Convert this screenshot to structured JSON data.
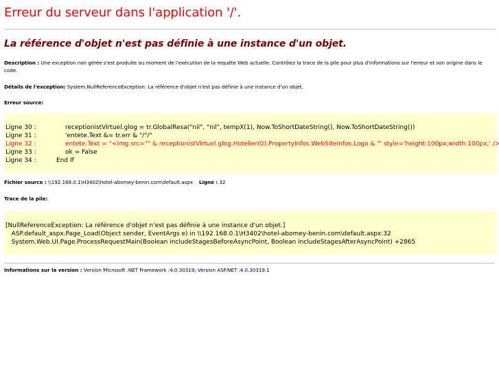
{
  "server_error_title": "Erreur du serveur dans l'application '/'.",
  "error_title": "La référence d'objet n'est pas définie à une instance d'un objet.",
  "description": {
    "label": "Description :",
    "text": " Une exception non gérée s'est produite au moment de l'exécution de la requête Web actuelle. Contrôlez la trace de la pile pour plus d'informations sur l'erreur et son origine dans le code."
  },
  "exception_details": {
    "label": "Détails de l'exception:",
    "text": " System.NullReferenceException: La référence d'objet n'est pas définie à une instance d'un objet."
  },
  "source_error_label": "Erreur source:",
  "source_lines": [
    {
      "label": "Ligne 30 :",
      "code": "receptionistVirtuel.glog = tr.GlobalResa(\"nil\", \"nil\", tempX(1), Now.ToShortDateString(), Now.ToShortDateString())",
      "highlight": false
    },
    {
      "label": "Ligne 31 :",
      "code": "'entete.Text &= tr.err & \"/\"/\"",
      "highlight": false
    },
    {
      "label": "Ligne 32 :",
      "code": "entete.Text = \"<img src=\"\" & receptionistVirtuel.glog.Hotelier(0).PropertyInfos.WebSiteInfos.Logo & \"' style='height:100px;width:100px;' />\"",
      "highlight": true
    },
    {
      "label": "Ligne 33 :",
      "code": "ok = False",
      "highlight": false
    },
    {
      "label": "Ligne 34 :",
      "code": "End If",
      "highlight": false
    }
  ],
  "source_file": {
    "label": "Fichier source :",
    "path": " \\\\192.168.0.1\\H3402\\hotel-abomey-benin.com\\default.aspx",
    "line_label": "Ligne :",
    "line_value": " 32"
  },
  "stack_trace_label": "Trace de la pile:",
  "stack_trace": [
    "[NullReferenceException: La référence d'objet n'est pas définie à une instance d'un objet.]",
    "   ASP.default_aspx.Page_Load(Object sender, EventArgs e) in \\\\192.168.0.1\\H3402\\hotel-abomey-benin.com\\default.aspx:32",
    "   System.Web.UI.Page.ProcessRequestMain(Boolean includeStagesBeforeAsyncPoint, Boolean includeStagesAfterAsyncPoint) +2865"
  ],
  "version": {
    "label": "Informations sur la version :",
    "text": " Version Microsoft .NET Framework :4.0.30319; Version ASP.NET :4.0.30319.1"
  },
  "colors": {
    "server_title": "#ff0000",
    "error_title": "#800000",
    "code_background": "#ffffcc",
    "highlight_line": "#ff0000",
    "divider": "#c0c0c0"
  }
}
